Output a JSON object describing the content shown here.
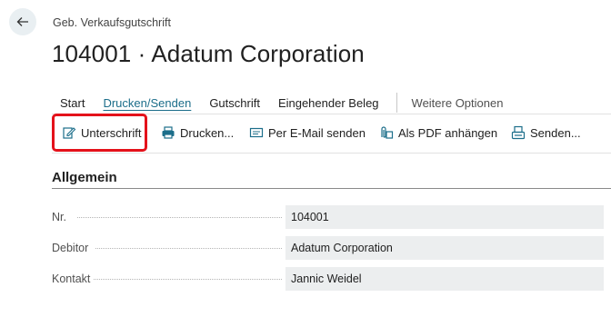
{
  "breadcrumb": "Geb. Verkaufsgutschrift",
  "title": "104001 · Adatum Corporation",
  "tabs": {
    "start": "Start",
    "drucken_senden": "Drucken/Senden",
    "gutschrift": "Gutschrift",
    "eingehender_beleg": "Eingehender Beleg",
    "weitere_optionen": "Weitere Optionen"
  },
  "actions": {
    "unterschrift": "Unterschrift",
    "drucken": "Drucken...",
    "email": "Per E-Mail senden",
    "pdf": "Als PDF anhängen",
    "senden": "Senden..."
  },
  "section": {
    "title": "Allgemein"
  },
  "fields": {
    "nr": {
      "label": "Nr.",
      "value": "104001"
    },
    "debitor": {
      "label": "Debitor",
      "value": "Adatum Corporation"
    },
    "kontakt": {
      "label": "Kontakt",
      "value": "Jannic Weidel"
    }
  },
  "colors": {
    "accent": "#1c6e8a",
    "highlight": "#e4121b",
    "field_bg": "#eceeef"
  }
}
